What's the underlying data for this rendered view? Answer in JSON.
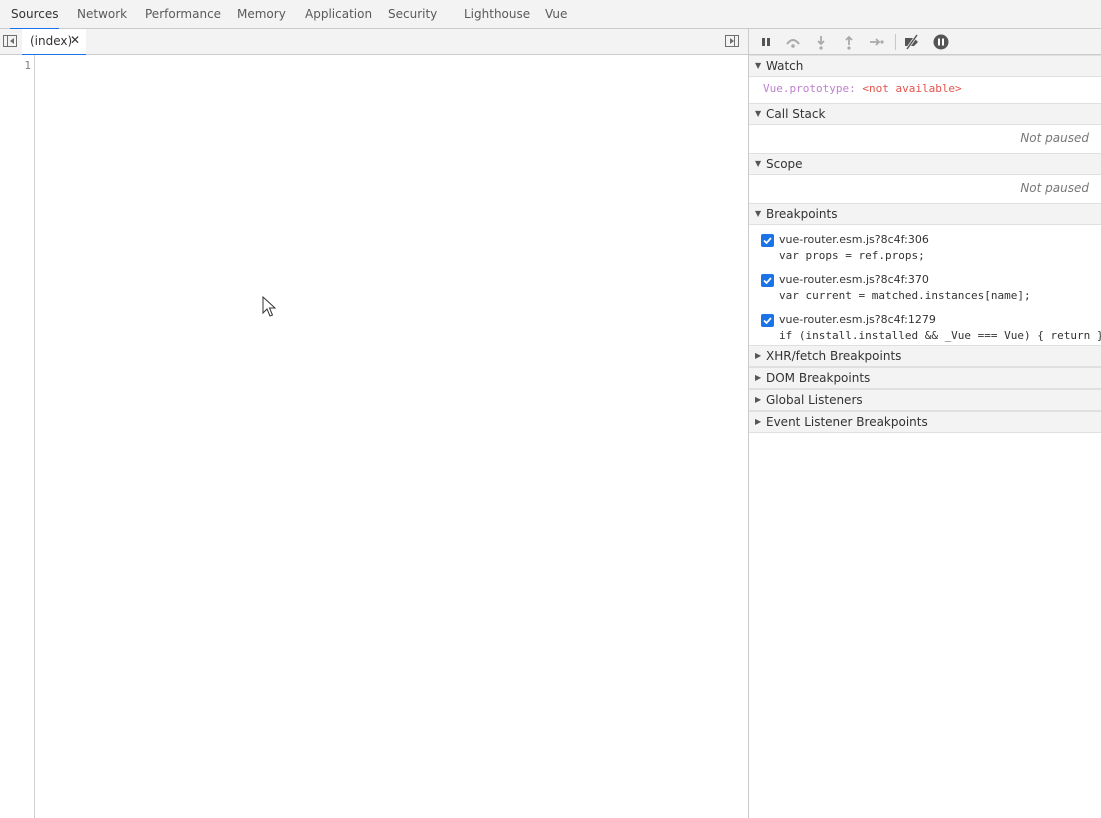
{
  "tabs": [
    {
      "label": "Sources",
      "active": true
    },
    {
      "label": "Network"
    },
    {
      "label": "Performance"
    },
    {
      "label": "Memory"
    },
    {
      "label": "Application"
    },
    {
      "label": "Security"
    },
    {
      "label": "Lighthouse"
    },
    {
      "label": "Vue"
    }
  ],
  "editor": {
    "file_tab": "(index)",
    "close_glyph": "✕",
    "line_number": "1"
  },
  "debugger": {
    "watch": {
      "title": "Watch",
      "expression": "Vue.prototype:",
      "value": "<not available>"
    },
    "call_stack": {
      "title": "Call Stack",
      "status": "Not paused"
    },
    "scope": {
      "title": "Scope",
      "status": "Not paused"
    },
    "breakpoints": {
      "title": "Breakpoints",
      "items": [
        {
          "location": "vue-router.esm.js?8c4f:306",
          "code": "var props = ref.props;",
          "checked": true
        },
        {
          "location": "vue-router.esm.js?8c4f:370",
          "code": "var current = matched.instances[name];",
          "checked": true
        },
        {
          "location": "vue-router.esm.js?8c4f:1279",
          "code": "if (install.installed && _Vue === Vue) { return }",
          "checked": true
        }
      ]
    },
    "collapsed_panes": [
      {
        "title": "XHR/fetch Breakpoints"
      },
      {
        "title": "DOM Breakpoints"
      },
      {
        "title": "Global Listeners"
      },
      {
        "title": "Event Listener Breakpoints"
      }
    ]
  },
  "colors": {
    "accent": "#1a73e8",
    "toolbar_bg": "#f3f3f3",
    "watch_expr": "#c080d0",
    "watch_value": "#e5534b"
  }
}
